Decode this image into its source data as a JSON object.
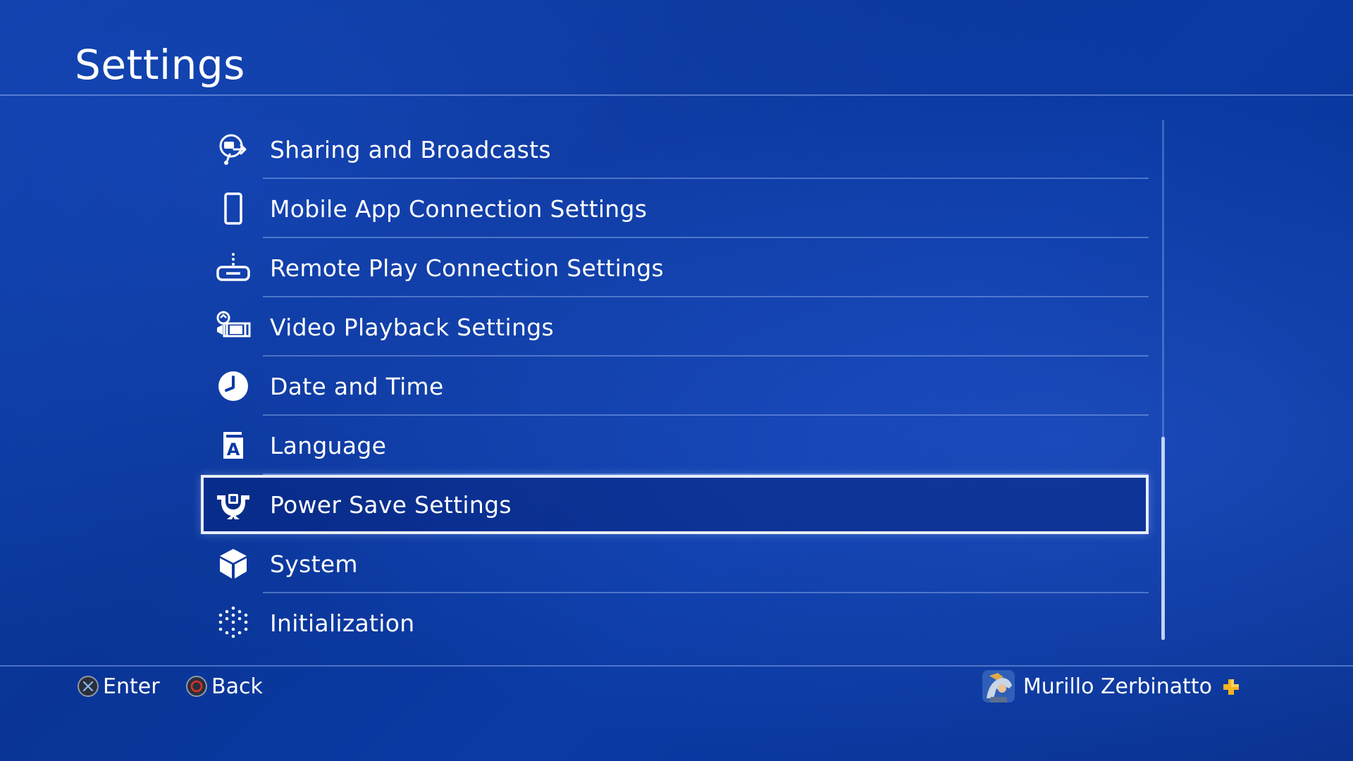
{
  "header": {
    "title": "Settings"
  },
  "menu": {
    "items": [
      {
        "label": "Sharing and Broadcasts",
        "icon": "share-broadcast-icon",
        "selected": false
      },
      {
        "label": "Mobile App Connection Settings",
        "icon": "smartphone-icon",
        "selected": false
      },
      {
        "label": "Remote Play Connection Settings",
        "icon": "remote-play-icon",
        "selected": false
      },
      {
        "label": "Video Playback Settings",
        "icon": "video-film-icon",
        "selected": false
      },
      {
        "label": "Date and Time",
        "icon": "clock-icon",
        "selected": false
      },
      {
        "label": "Language",
        "icon": "language-icon",
        "selected": false
      },
      {
        "label": "Power Save Settings",
        "icon": "power-save-icon",
        "selected": true
      },
      {
        "label": "System",
        "icon": "cube-icon",
        "selected": false
      },
      {
        "label": "Initialization",
        "icon": "dotted-cube-icon",
        "selected": false
      }
    ]
  },
  "footer": {
    "enter_label": "Enter",
    "back_label": "Back",
    "enter_button_icon": "cross-button-icon",
    "back_button_icon": "circle-button-icon"
  },
  "user": {
    "name": "Murillo Zerbinatto",
    "plus_icon": "ps-plus-icon",
    "plus_color": "#f5b51e"
  },
  "colors": {
    "background": "#0b3aa4",
    "selection_outline": "#e8eef8",
    "circle_button": "#d9322c"
  }
}
